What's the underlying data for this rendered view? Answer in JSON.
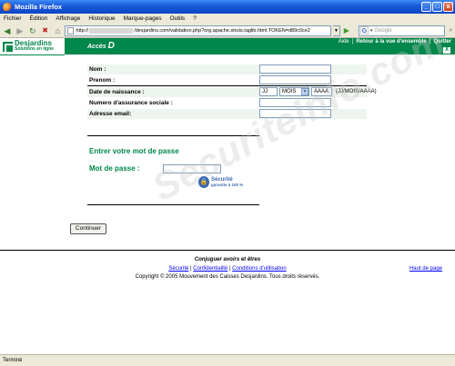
{
  "window": {
    "title": "Mozilla Firefox",
    "min": "_",
    "max": "□",
    "close": "x"
  },
  "menu": [
    "Fichier",
    "Édition",
    "Affichage",
    "Historique",
    "Marque-pages",
    "Outils",
    "?"
  ],
  "nav": {
    "url_prefix": "http://",
    "url_suffix": "/desjardins.com/validation.php?org.apache.struts.taglib.html.TOKEN=d89c0ce2",
    "search_placeholder": "Google"
  },
  "header": {
    "brand": "Desjardins",
    "tagline": "Solutions en ligne",
    "product_prefix": "Accès",
    "product_letter": "D",
    "aide": "Aide",
    "sep": "|",
    "retour": "Retour à la vue d'ensemble",
    "quitter": "Quitter",
    "close": "X"
  },
  "form": {
    "nom_label": "Nom :",
    "prenom_label": "Prenom :",
    "naissance_label": "Date de naissance :",
    "jj_value": "JJ",
    "mois_value": "MOIS",
    "aaaa_value": "AAAA",
    "date_format": "(JJ/MOIS/AAAA)",
    "nas_label": "Numero d'assurance sociale :",
    "email_label": "Adresse email:"
  },
  "password": {
    "title": "Entrer votre mot de passe",
    "label": "Mot de passe :",
    "secure_title": "Sécurité",
    "secure_sub": "garantie à 100 %"
  },
  "continue_label": "Continuer",
  "footer": {
    "slogan": "Conjuguer avoirs et êtres",
    "link_securite": "Sécurité",
    "link_confidentialite": "Confidentialité",
    "link_conditions": "Conditions d'utilisation",
    "sep": "|",
    "haut_page": "Haut de page",
    "copyright": "Copyright © 2005 Mouvement des Caisses Desjardins. Tous droits réservés."
  },
  "watermark": "SecuriteInfo.com",
  "status": "Terminé"
}
